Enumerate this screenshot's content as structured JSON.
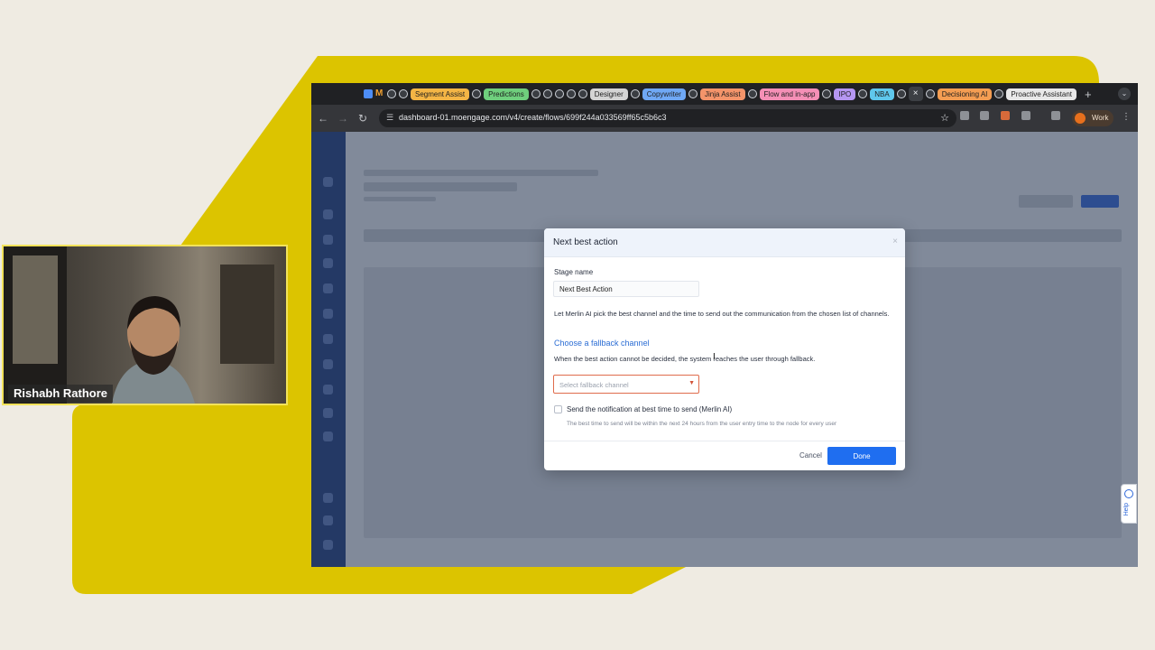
{
  "colors": {
    "background": "#efebe2",
    "accent_yellow": "#dcc400",
    "primary_blue": "#1f6ef0",
    "link_blue": "#2b6dd4",
    "error_border": "#e06c4c"
  },
  "webcam": {
    "name": "Rishabh Rathore"
  },
  "browser": {
    "tab_groups": [
      {
        "label": "Segment Assist",
        "color": "#f4b545"
      },
      {
        "label": "Predictions",
        "color": "#6fcf7d"
      },
      {
        "label": "Designer",
        "color": "#d4d4d4"
      },
      {
        "label": "Copywriter",
        "color": "#6fa8f5"
      },
      {
        "label": "Jinja Assist",
        "color": "#f4946a"
      },
      {
        "label": "Flow and in-app",
        "color": "#f58fb6"
      },
      {
        "label": "IPO",
        "color": "#b596f2"
      },
      {
        "label": "NBA",
        "color": "#5fc7ec"
      },
      {
        "label": "Decisioning AI",
        "color": "#f49d52"
      },
      {
        "label": "Proactive Assistant",
        "color": "#e8e8e8"
      }
    ],
    "active_tab_close": "×",
    "new_tab": "+",
    "url": "dashboard-01.moengage.com/v4/create/flows/699f244a033569ff65c5b6c3",
    "profile_label": "Work",
    "icons": [
      "back-arrow-icon",
      "forward-arrow-icon",
      "reload-icon",
      "site-settings-icon",
      "bookmark-star-icon",
      "menu-icon"
    ]
  },
  "help": {
    "label": "Help"
  },
  "modal": {
    "title": "Next best action",
    "close": "×",
    "stage_name_label": "Stage name",
    "stage_name_value": "Next Best Action",
    "description": "Let Merlin AI pick the best channel and the time to send out the communication from the chosen list of channels.",
    "fallback_title": "Choose a fallback channel",
    "fallback_description": "When the best action cannot be decided, the system reaches the user through fallback.",
    "fallback_placeholder": "Select fallback channel",
    "best_time_checked": false,
    "best_time_label": "Send the notification at best time to send (Merlin AI)",
    "best_time_hint": "The best time to send will be within the next 24 hours from the user entry time to the node for every user",
    "cancel_label": "Cancel",
    "done_label": "Done"
  }
}
